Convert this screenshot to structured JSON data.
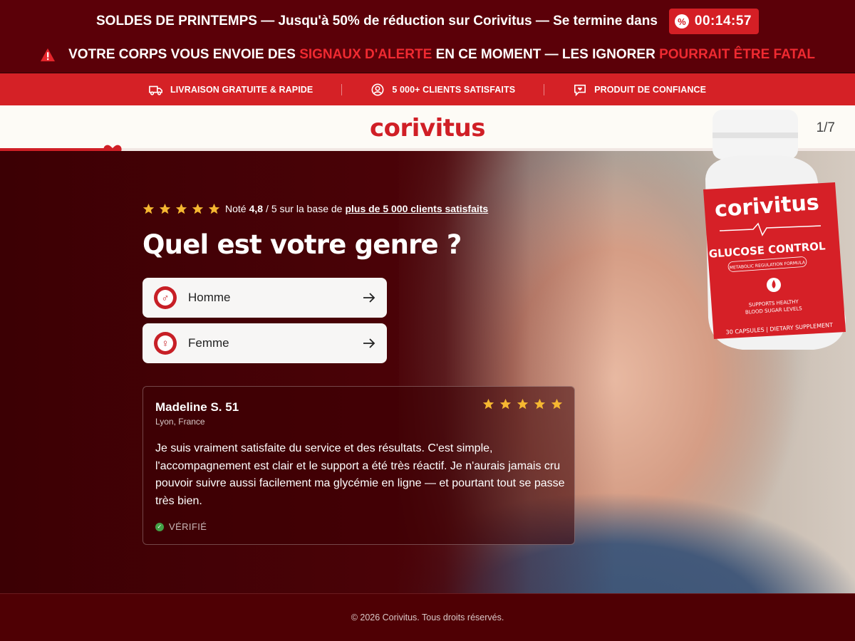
{
  "promo": {
    "sale_text": "SOLDES DE PRINTEMPS — Jusqu'à 50% de réduction sur Corivitus — Se termine dans",
    "timer_icon": "discount-icon",
    "timer": "00:14:57",
    "warning_prefix": "VOTRE CORPS VOUS ENVOIE DES",
    "warning_red1": "SIGNAUX D'ALERTE",
    "warning_mid": "EN CE MOMENT — LES IGNORER",
    "warning_red2": "POURRAIT ÊTRE FATAL"
  },
  "features": [
    {
      "icon": "truck-icon",
      "label": "LIVRAISON GRATUITE & RAPIDE"
    },
    {
      "icon": "user-circle-icon",
      "label": "5 000+ CLIENTS SATISFAITS"
    },
    {
      "icon": "heart-chat-icon",
      "label": "PRODUIT DE CONFIANCE"
    }
  ],
  "header": {
    "logo": "corivitus",
    "step": "1/7",
    "progress": 0.13
  },
  "rating": {
    "prefix": "Noté",
    "score": "4,8",
    "middle": "/ 5 sur la base de",
    "link": "plus de 5 000 clients satisfaits",
    "stars": 5
  },
  "question": "Quel est votre genre ?",
  "options": [
    {
      "icon": "male-icon",
      "label": "Homme"
    },
    {
      "icon": "female-icon",
      "label": "Femme"
    }
  ],
  "review": {
    "name": "Madeline S. 51",
    "location": "Lyon, France",
    "stars": 5,
    "text": "Je suis vraiment satisfaite du service et des résultats. C'est simple, l'accompagnement est clair et le support a été très réactif. Je n'aurais jamais cru pouvoir suivre aussi facilement ma glycémie en ligne — et pourtant tout se passe très bien.",
    "verified": "VÉRIFIÉ"
  },
  "product": {
    "brand": "corivitus",
    "name": "GLUCOSE CONTROL",
    "subtitle": "METABOLIC REGULATION FORMULA",
    "claim_line1": "SUPPORTS HEALTHY",
    "claim_line2": "BLOOD SUGAR LEVELS",
    "footer": "30 CAPSULES | DIETARY SUPPLEMENT"
  },
  "footer": "© 2026 Corivitus. Tous droits réservés.",
  "colors": {
    "brand_red": "#d01f26",
    "dark_maroon": "#4a0006",
    "star_gold": "#f5b731"
  }
}
